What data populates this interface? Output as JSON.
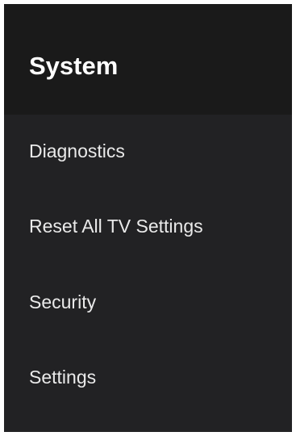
{
  "header": {
    "title": "System"
  },
  "menu": {
    "items": [
      {
        "label": "Diagnostics"
      },
      {
        "label": "Reset All TV Settings"
      },
      {
        "label": "Security"
      },
      {
        "label": "Settings"
      }
    ]
  },
  "colors": {
    "header_background": "#1a1a1a",
    "panel_background": "#222224",
    "text": "#eaeaea"
  }
}
